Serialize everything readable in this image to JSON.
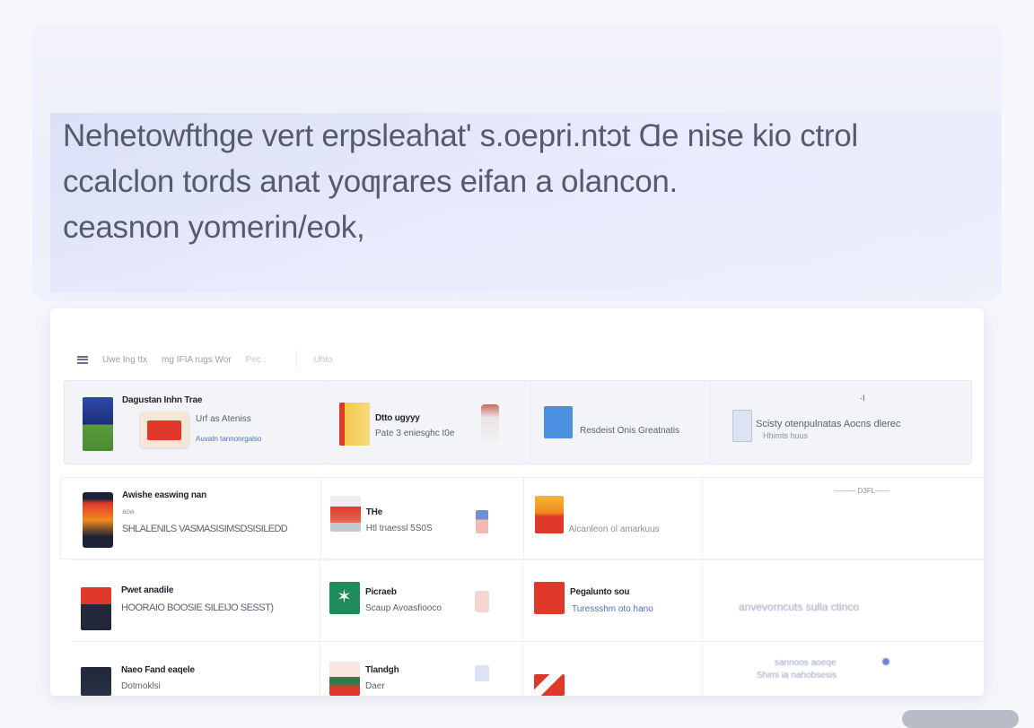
{
  "hero": {
    "lines": [
      "Nehetowfthge vert erpsleahat' s.oepri.ntɔt  Ɑe nise kio ctrol",
      "ccalclon tords anat yoƣrares  eifan a olancon.",
      "ceasnon yomerin/eok,"
    ]
  },
  "toolbar": {
    "items": [
      "Uwe Ing ttx",
      "mg IFIA rugs Wor",
      "Pec :"
    ],
    "last_item": "Uhto"
  },
  "rows": [
    {
      "cells": [
        {
          "title": "Dagustan Inhn Trae",
          "line2": "Urf as Ateniss",
          "line3": "Auvatn tannonrgalso"
        },
        {
          "title": "Dtto ugyyy",
          "line2": "Pate 3 eniesghc t0e"
        },
        {
          "title": "Resdeist Onis  Greatnatis"
        },
        {
          "title": "Scisty otenpulnatas  Aocns dlerec",
          "line2": "Hhimts  huus",
          "marker": "·I"
        }
      ]
    },
    {
      "cells": [
        {
          "title": "Awishe easwing nan",
          "line2": "aoa",
          "line3": "SHLALENILS VASMASISIMSDSISILEDD"
        },
        {
          "title": "THe",
          "line2": "Htl tnaessl 5S0S"
        },
        {
          "title": "Alcanleon ol amarkuus"
        },
        {
          "title": "——— D3FL——"
        }
      ]
    },
    {
      "cells": [
        {
          "title": "Pwet anadile",
          "line2": "HOORAIO BOOSIE SILEIJO SESST)"
        },
        {
          "title": "Picraeb",
          "line2": "Scaup Avoasfiooco"
        },
        {
          "title": "Pegalunto sou",
          "line2": "Turessshm oto hano"
        },
        {
          "title": "anvevorncuts sulla ctinco"
        }
      ]
    },
    {
      "cells": [
        {
          "title": "Naeo Fand eaqele",
          "line2": "Dotmoklsi"
        },
        {
          "title": "Tlandgh",
          "line2": "Daer"
        },
        {
          "title": ""
        },
        {
          "title": "sannoos aoeqe",
          "line2": "Shimi ia nahobsesis"
        }
      ]
    }
  ],
  "colors": {
    "accent_blue": "#4f6fd4",
    "red": "#e0392b",
    "orange": "#f08a1c",
    "green": "#1f8a5c"
  }
}
